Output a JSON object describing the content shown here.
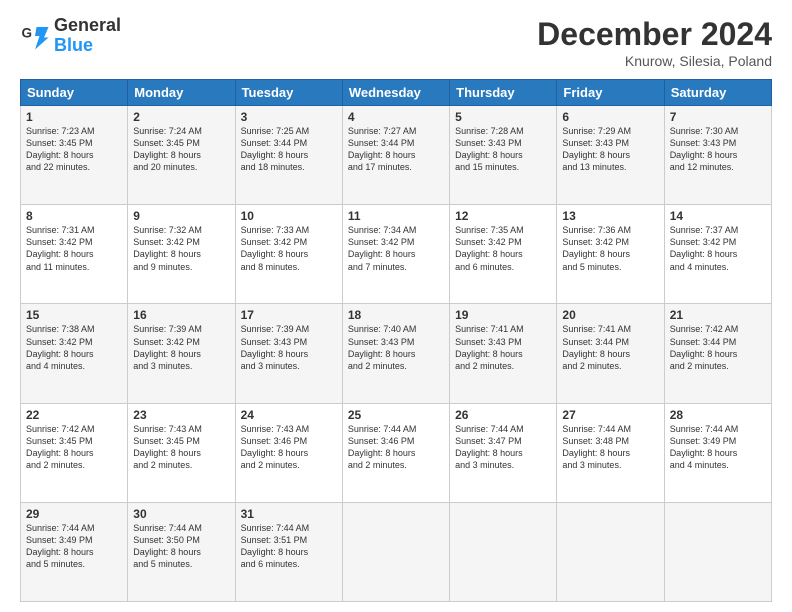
{
  "header": {
    "logo_line1": "General",
    "logo_line2": "Blue",
    "month_title": "December 2024",
    "location": "Knurow, Silesia, Poland"
  },
  "weekdays": [
    "Sunday",
    "Monday",
    "Tuesday",
    "Wednesday",
    "Thursday",
    "Friday",
    "Saturday"
  ],
  "weeks": [
    [
      {
        "day": "1",
        "info": "Sunrise: 7:23 AM\nSunset: 3:45 PM\nDaylight: 8 hours\nand 22 minutes."
      },
      {
        "day": "2",
        "info": "Sunrise: 7:24 AM\nSunset: 3:45 PM\nDaylight: 8 hours\nand 20 minutes."
      },
      {
        "day": "3",
        "info": "Sunrise: 7:25 AM\nSunset: 3:44 PM\nDaylight: 8 hours\nand 18 minutes."
      },
      {
        "day": "4",
        "info": "Sunrise: 7:27 AM\nSunset: 3:44 PM\nDaylight: 8 hours\nand 17 minutes."
      },
      {
        "day": "5",
        "info": "Sunrise: 7:28 AM\nSunset: 3:43 PM\nDaylight: 8 hours\nand 15 minutes."
      },
      {
        "day": "6",
        "info": "Sunrise: 7:29 AM\nSunset: 3:43 PM\nDaylight: 8 hours\nand 13 minutes."
      },
      {
        "day": "7",
        "info": "Sunrise: 7:30 AM\nSunset: 3:43 PM\nDaylight: 8 hours\nand 12 minutes."
      }
    ],
    [
      {
        "day": "8",
        "info": "Sunrise: 7:31 AM\nSunset: 3:42 PM\nDaylight: 8 hours\nand 11 minutes."
      },
      {
        "day": "9",
        "info": "Sunrise: 7:32 AM\nSunset: 3:42 PM\nDaylight: 8 hours\nand 9 minutes."
      },
      {
        "day": "10",
        "info": "Sunrise: 7:33 AM\nSunset: 3:42 PM\nDaylight: 8 hours\nand 8 minutes."
      },
      {
        "day": "11",
        "info": "Sunrise: 7:34 AM\nSunset: 3:42 PM\nDaylight: 8 hours\nand 7 minutes."
      },
      {
        "day": "12",
        "info": "Sunrise: 7:35 AM\nSunset: 3:42 PM\nDaylight: 8 hours\nand 6 minutes."
      },
      {
        "day": "13",
        "info": "Sunrise: 7:36 AM\nSunset: 3:42 PM\nDaylight: 8 hours\nand 5 minutes."
      },
      {
        "day": "14",
        "info": "Sunrise: 7:37 AM\nSunset: 3:42 PM\nDaylight: 8 hours\nand 4 minutes."
      }
    ],
    [
      {
        "day": "15",
        "info": "Sunrise: 7:38 AM\nSunset: 3:42 PM\nDaylight: 8 hours\nand 4 minutes."
      },
      {
        "day": "16",
        "info": "Sunrise: 7:39 AM\nSunset: 3:42 PM\nDaylight: 8 hours\nand 3 minutes."
      },
      {
        "day": "17",
        "info": "Sunrise: 7:39 AM\nSunset: 3:43 PM\nDaylight: 8 hours\nand 3 minutes."
      },
      {
        "day": "18",
        "info": "Sunrise: 7:40 AM\nSunset: 3:43 PM\nDaylight: 8 hours\nand 2 minutes."
      },
      {
        "day": "19",
        "info": "Sunrise: 7:41 AM\nSunset: 3:43 PM\nDaylight: 8 hours\nand 2 minutes."
      },
      {
        "day": "20",
        "info": "Sunrise: 7:41 AM\nSunset: 3:44 PM\nDaylight: 8 hours\nand 2 minutes."
      },
      {
        "day": "21",
        "info": "Sunrise: 7:42 AM\nSunset: 3:44 PM\nDaylight: 8 hours\nand 2 minutes."
      }
    ],
    [
      {
        "day": "22",
        "info": "Sunrise: 7:42 AM\nSunset: 3:45 PM\nDaylight: 8 hours\nand 2 minutes."
      },
      {
        "day": "23",
        "info": "Sunrise: 7:43 AM\nSunset: 3:45 PM\nDaylight: 8 hours\nand 2 minutes."
      },
      {
        "day": "24",
        "info": "Sunrise: 7:43 AM\nSunset: 3:46 PM\nDaylight: 8 hours\nand 2 minutes."
      },
      {
        "day": "25",
        "info": "Sunrise: 7:44 AM\nSunset: 3:46 PM\nDaylight: 8 hours\nand 2 minutes."
      },
      {
        "day": "26",
        "info": "Sunrise: 7:44 AM\nSunset: 3:47 PM\nDaylight: 8 hours\nand 3 minutes."
      },
      {
        "day": "27",
        "info": "Sunrise: 7:44 AM\nSunset: 3:48 PM\nDaylight: 8 hours\nand 3 minutes."
      },
      {
        "day": "28",
        "info": "Sunrise: 7:44 AM\nSunset: 3:49 PM\nDaylight: 8 hours\nand 4 minutes."
      }
    ],
    [
      {
        "day": "29",
        "info": "Sunrise: 7:44 AM\nSunset: 3:49 PM\nDaylight: 8 hours\nand 5 minutes."
      },
      {
        "day": "30",
        "info": "Sunrise: 7:44 AM\nSunset: 3:50 PM\nDaylight: 8 hours\nand 5 minutes."
      },
      {
        "day": "31",
        "info": "Sunrise: 7:44 AM\nSunset: 3:51 PM\nDaylight: 8 hours\nand 6 minutes."
      },
      null,
      null,
      null,
      null
    ]
  ]
}
